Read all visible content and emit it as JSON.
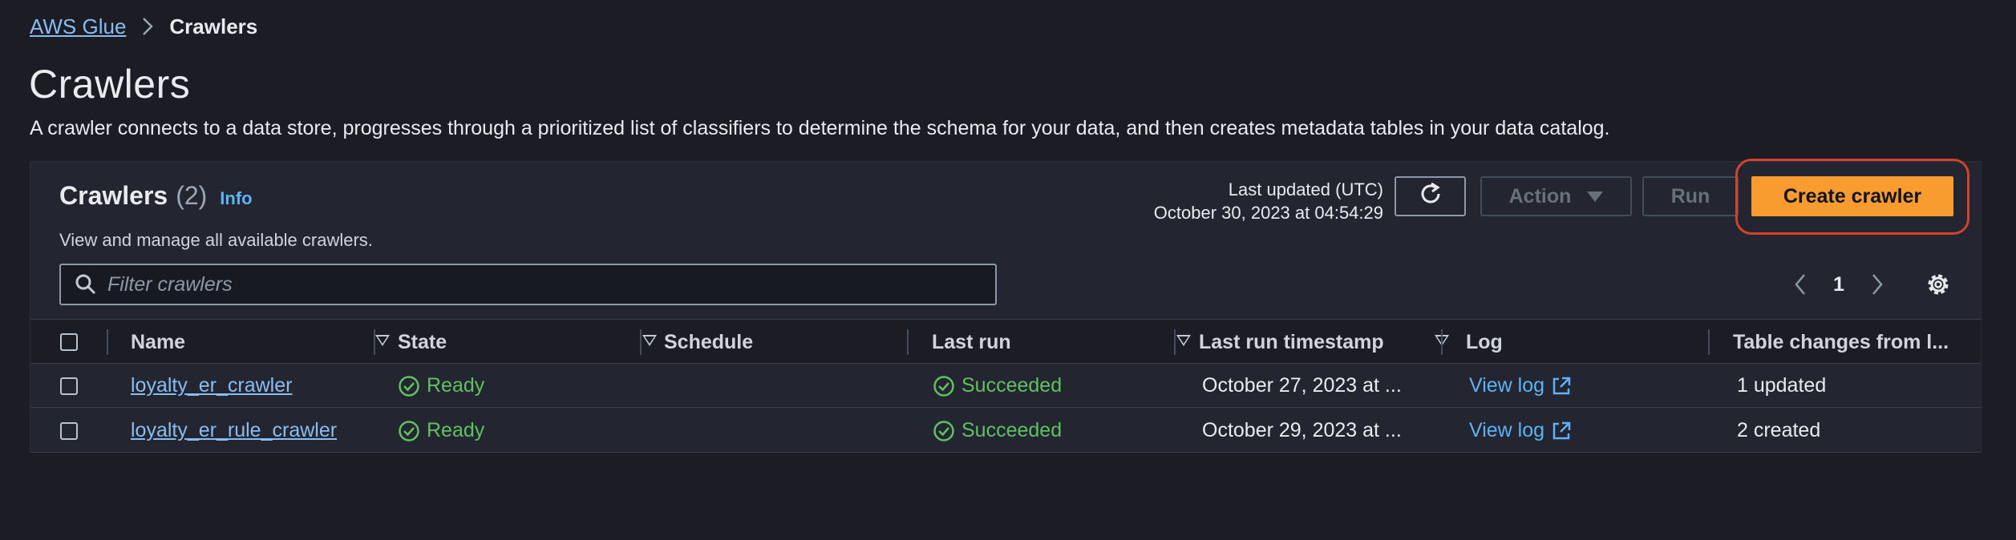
{
  "breadcrumb": {
    "root": "AWS Glue",
    "current": "Crawlers"
  },
  "page": {
    "title": "Crawlers",
    "description": "A crawler connects to a data store, progresses through a prioritized list of classifiers to determine the schema for your data, and then creates metadata tables in your data catalog."
  },
  "panel": {
    "title": "Crawlers",
    "count": "(2)",
    "info": "Info",
    "subtitle": "View and manage all available crawlers.",
    "last_updated_label": "Last updated (UTC)",
    "last_updated_value": "October 30, 2023 at 04:54:29",
    "action_label": "Action",
    "run_label": "Run",
    "create_label": "Create crawler",
    "search_placeholder": "Filter crawlers",
    "page_number": "1"
  },
  "table": {
    "headers": {
      "name": "Name",
      "state": "State",
      "schedule": "Schedule",
      "last_run": "Last run",
      "last_run_timestamp": "Last run timestamp",
      "log": "Log",
      "table_changes": "Table changes from l..."
    },
    "rows": [
      {
        "name": "loyalty_er_crawler",
        "state": "Ready",
        "schedule": "",
        "last_run": "Succeeded",
        "timestamp": "October 27, 2023 at ...",
        "log": "View log",
        "changes": "1 updated"
      },
      {
        "name": "loyalty_er_rule_crawler",
        "state": "Ready",
        "schedule": "",
        "last_run": "Succeeded",
        "timestamp": "October 29, 2023 at ...",
        "log": "View log",
        "changes": "2 created"
      }
    ]
  },
  "colors": {
    "accent": "#f89c2f",
    "link": "#89bdf0",
    "success": "#5fc160",
    "highlight": "#d4412d"
  }
}
